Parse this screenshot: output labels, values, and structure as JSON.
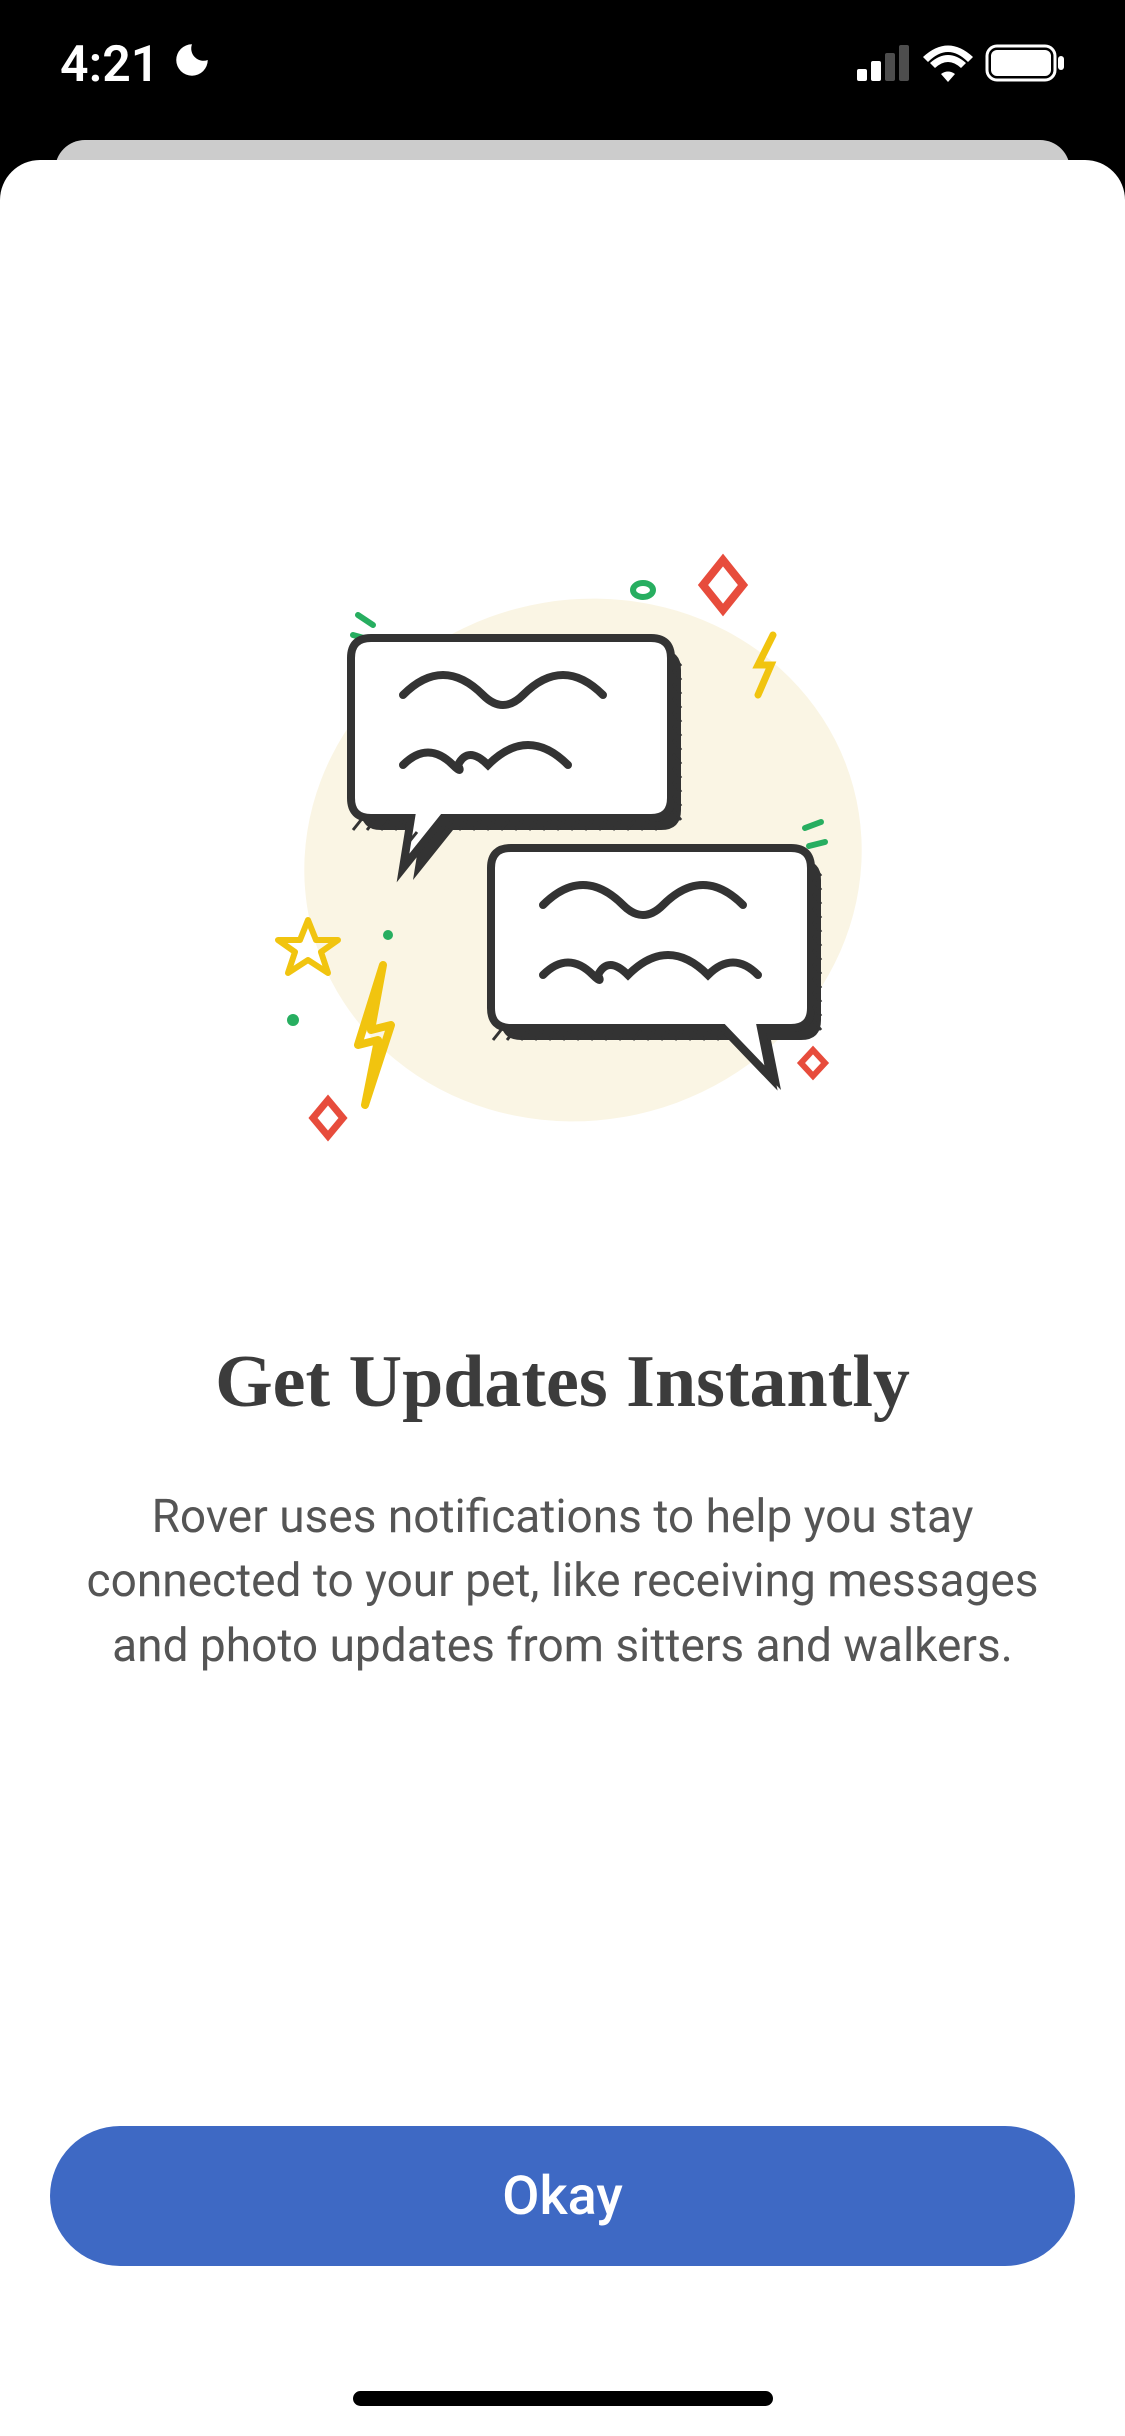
{
  "statusBar": {
    "time": "4:21",
    "moonIcon": "moon"
  },
  "modal": {
    "heading": "Get Updates Instantly",
    "body": "Rover uses notifications to help you stay connected to your pet, like receiving messages and photo updates from sitters and walkers.",
    "primaryButtonLabel": "Okay"
  }
}
